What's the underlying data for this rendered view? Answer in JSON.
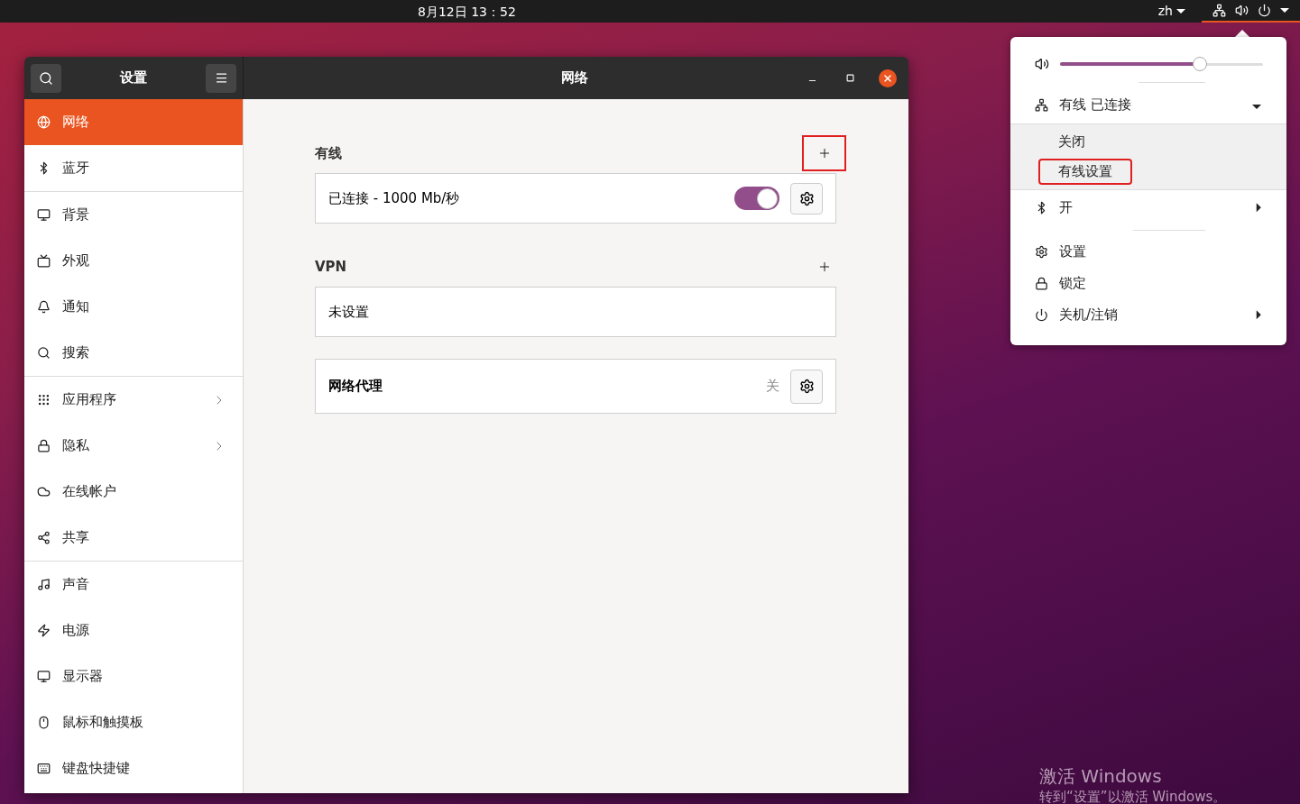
{
  "top_bar": {
    "clock": "8月12日  13：52",
    "input_method": "zh",
    "system_menu_open": true
  },
  "settings_window": {
    "sidebar_title": "设置",
    "title": "网络",
    "sidebar": {
      "groups": [
        [
          {
            "label": "网络",
            "selected": true,
            "has_submenu": false
          },
          {
            "label": "蓝牙",
            "selected": false,
            "has_submenu": false
          }
        ],
        [
          {
            "label": "背景",
            "selected": false,
            "has_submenu": false
          },
          {
            "label": "外观",
            "selected": false,
            "has_submenu": false
          },
          {
            "label": "通知",
            "selected": false,
            "has_submenu": false
          },
          {
            "label": "搜索",
            "selected": false,
            "has_submenu": false
          }
        ],
        [
          {
            "label": "应用程序",
            "selected": false,
            "has_submenu": true
          },
          {
            "label": "隐私",
            "selected": false,
            "has_submenu": true
          },
          {
            "label": "在线帐户",
            "selected": false,
            "has_submenu": false
          },
          {
            "label": "共享",
            "selected": false,
            "has_submenu": false
          }
        ],
        [
          {
            "label": "声音",
            "selected": false,
            "has_submenu": false
          },
          {
            "label": "电源",
            "selected": false,
            "has_submenu": false
          },
          {
            "label": "显示器",
            "selected": false,
            "has_submenu": false
          },
          {
            "label": "鼠标和触摸板",
            "selected": false,
            "has_submenu": false
          },
          {
            "label": "键盘快捷键",
            "selected": false,
            "has_submenu": false
          }
        ]
      ]
    },
    "wired": {
      "heading": "有线",
      "add_annotated": true,
      "connection": {
        "label": "已连接 - 1000 Mb/秒",
        "on": true
      }
    },
    "vpn": {
      "heading": "VPN",
      "add_annotated": false,
      "status": "未设置"
    },
    "proxy": {
      "label": "网络代理",
      "status": "关"
    }
  },
  "system_menu": {
    "volume": {
      "level": 0.69
    },
    "wired": {
      "label": "有线 已连接",
      "expanded": true,
      "items": [
        {
          "label": "关闭",
          "annotated": false
        },
        {
          "label": "有线设置",
          "annotated": true
        }
      ]
    },
    "bluetooth": {
      "label": "开"
    },
    "actions": [
      {
        "label": "设置",
        "has_submenu": false
      },
      {
        "label": "锁定",
        "has_submenu": false
      },
      {
        "label": "关机/注销",
        "has_submenu": true
      }
    ]
  },
  "activation_notice": {
    "title": "激活 Windows",
    "message": "转到“设置”以激活 Windows。"
  }
}
